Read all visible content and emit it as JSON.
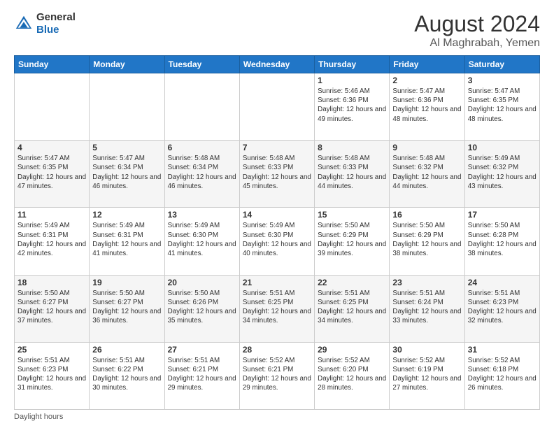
{
  "header": {
    "logo_general": "General",
    "logo_blue": "Blue",
    "month_year": "August 2024",
    "location": "Al Maghrabah, Yemen"
  },
  "days_of_week": [
    "Sunday",
    "Monday",
    "Tuesday",
    "Wednesday",
    "Thursday",
    "Friday",
    "Saturday"
  ],
  "footer": {
    "daylight_hours": "Daylight hours"
  },
  "weeks": [
    [
      {
        "day": "",
        "sunrise": "",
        "sunset": "",
        "daylight": ""
      },
      {
        "day": "",
        "sunrise": "",
        "sunset": "",
        "daylight": ""
      },
      {
        "day": "",
        "sunrise": "",
        "sunset": "",
        "daylight": ""
      },
      {
        "day": "",
        "sunrise": "",
        "sunset": "",
        "daylight": ""
      },
      {
        "day": "1",
        "sunrise": "Sunrise: 5:46 AM",
        "sunset": "Sunset: 6:36 PM",
        "daylight": "Daylight: 12 hours and 49 minutes."
      },
      {
        "day": "2",
        "sunrise": "Sunrise: 5:47 AM",
        "sunset": "Sunset: 6:36 PM",
        "daylight": "Daylight: 12 hours and 48 minutes."
      },
      {
        "day": "3",
        "sunrise": "Sunrise: 5:47 AM",
        "sunset": "Sunset: 6:35 PM",
        "daylight": "Daylight: 12 hours and 48 minutes."
      }
    ],
    [
      {
        "day": "4",
        "sunrise": "Sunrise: 5:47 AM",
        "sunset": "Sunset: 6:35 PM",
        "daylight": "Daylight: 12 hours and 47 minutes."
      },
      {
        "day": "5",
        "sunrise": "Sunrise: 5:47 AM",
        "sunset": "Sunset: 6:34 PM",
        "daylight": "Daylight: 12 hours and 46 minutes."
      },
      {
        "day": "6",
        "sunrise": "Sunrise: 5:48 AM",
        "sunset": "Sunset: 6:34 PM",
        "daylight": "Daylight: 12 hours and 46 minutes."
      },
      {
        "day": "7",
        "sunrise": "Sunrise: 5:48 AM",
        "sunset": "Sunset: 6:33 PM",
        "daylight": "Daylight: 12 hours and 45 minutes."
      },
      {
        "day": "8",
        "sunrise": "Sunrise: 5:48 AM",
        "sunset": "Sunset: 6:33 PM",
        "daylight": "Daylight: 12 hours and 44 minutes."
      },
      {
        "day": "9",
        "sunrise": "Sunrise: 5:48 AM",
        "sunset": "Sunset: 6:32 PM",
        "daylight": "Daylight: 12 hours and 44 minutes."
      },
      {
        "day": "10",
        "sunrise": "Sunrise: 5:49 AM",
        "sunset": "Sunset: 6:32 PM",
        "daylight": "Daylight: 12 hours and 43 minutes."
      }
    ],
    [
      {
        "day": "11",
        "sunrise": "Sunrise: 5:49 AM",
        "sunset": "Sunset: 6:31 PM",
        "daylight": "Daylight: 12 hours and 42 minutes."
      },
      {
        "day": "12",
        "sunrise": "Sunrise: 5:49 AM",
        "sunset": "Sunset: 6:31 PM",
        "daylight": "Daylight: 12 hours and 41 minutes."
      },
      {
        "day": "13",
        "sunrise": "Sunrise: 5:49 AM",
        "sunset": "Sunset: 6:30 PM",
        "daylight": "Daylight: 12 hours and 41 minutes."
      },
      {
        "day": "14",
        "sunrise": "Sunrise: 5:49 AM",
        "sunset": "Sunset: 6:30 PM",
        "daylight": "Daylight: 12 hours and 40 minutes."
      },
      {
        "day": "15",
        "sunrise": "Sunrise: 5:50 AM",
        "sunset": "Sunset: 6:29 PM",
        "daylight": "Daylight: 12 hours and 39 minutes."
      },
      {
        "day": "16",
        "sunrise": "Sunrise: 5:50 AM",
        "sunset": "Sunset: 6:29 PM",
        "daylight": "Daylight: 12 hours and 38 minutes."
      },
      {
        "day": "17",
        "sunrise": "Sunrise: 5:50 AM",
        "sunset": "Sunset: 6:28 PM",
        "daylight": "Daylight: 12 hours and 38 minutes."
      }
    ],
    [
      {
        "day": "18",
        "sunrise": "Sunrise: 5:50 AM",
        "sunset": "Sunset: 6:27 PM",
        "daylight": "Daylight: 12 hours and 37 minutes."
      },
      {
        "day": "19",
        "sunrise": "Sunrise: 5:50 AM",
        "sunset": "Sunset: 6:27 PM",
        "daylight": "Daylight: 12 hours and 36 minutes."
      },
      {
        "day": "20",
        "sunrise": "Sunrise: 5:50 AM",
        "sunset": "Sunset: 6:26 PM",
        "daylight": "Daylight: 12 hours and 35 minutes."
      },
      {
        "day": "21",
        "sunrise": "Sunrise: 5:51 AM",
        "sunset": "Sunset: 6:25 PM",
        "daylight": "Daylight: 12 hours and 34 minutes."
      },
      {
        "day": "22",
        "sunrise": "Sunrise: 5:51 AM",
        "sunset": "Sunset: 6:25 PM",
        "daylight": "Daylight: 12 hours and 34 minutes."
      },
      {
        "day": "23",
        "sunrise": "Sunrise: 5:51 AM",
        "sunset": "Sunset: 6:24 PM",
        "daylight": "Daylight: 12 hours and 33 minutes."
      },
      {
        "day": "24",
        "sunrise": "Sunrise: 5:51 AM",
        "sunset": "Sunset: 6:23 PM",
        "daylight": "Daylight: 12 hours and 32 minutes."
      }
    ],
    [
      {
        "day": "25",
        "sunrise": "Sunrise: 5:51 AM",
        "sunset": "Sunset: 6:23 PM",
        "daylight": "Daylight: 12 hours and 31 minutes."
      },
      {
        "day": "26",
        "sunrise": "Sunrise: 5:51 AM",
        "sunset": "Sunset: 6:22 PM",
        "daylight": "Daylight: 12 hours and 30 minutes."
      },
      {
        "day": "27",
        "sunrise": "Sunrise: 5:51 AM",
        "sunset": "Sunset: 6:21 PM",
        "daylight": "Daylight: 12 hours and 29 minutes."
      },
      {
        "day": "28",
        "sunrise": "Sunrise: 5:52 AM",
        "sunset": "Sunset: 6:21 PM",
        "daylight": "Daylight: 12 hours and 29 minutes."
      },
      {
        "day": "29",
        "sunrise": "Sunrise: 5:52 AM",
        "sunset": "Sunset: 6:20 PM",
        "daylight": "Daylight: 12 hours and 28 minutes."
      },
      {
        "day": "30",
        "sunrise": "Sunrise: 5:52 AM",
        "sunset": "Sunset: 6:19 PM",
        "daylight": "Daylight: 12 hours and 27 minutes."
      },
      {
        "day": "31",
        "sunrise": "Sunrise: 5:52 AM",
        "sunset": "Sunset: 6:18 PM",
        "daylight": "Daylight: 12 hours and 26 minutes."
      }
    ]
  ]
}
